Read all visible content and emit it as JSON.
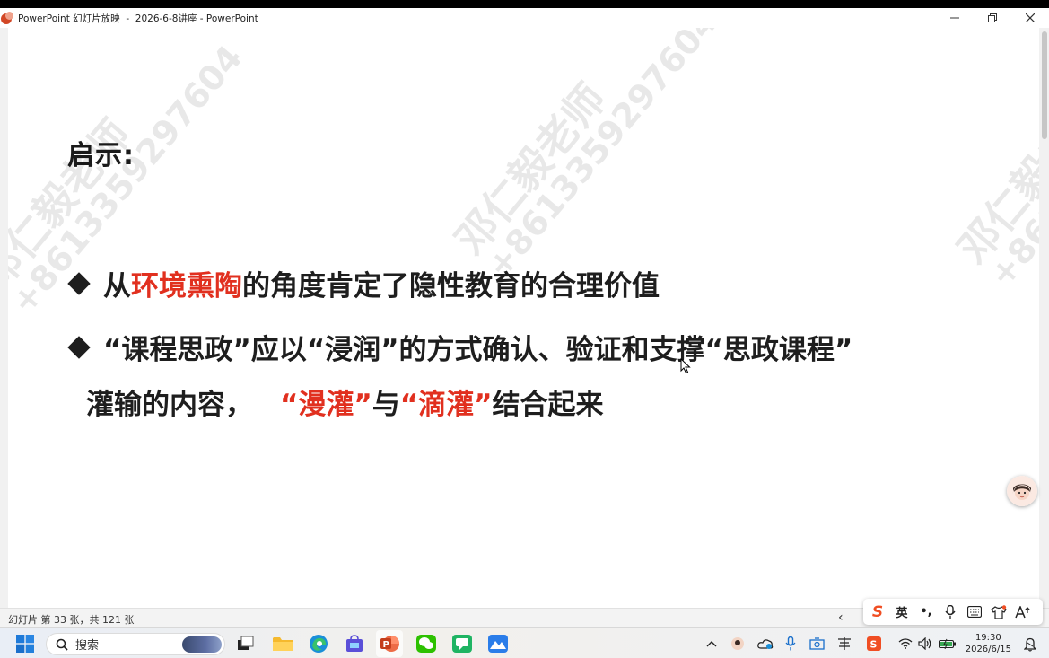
{
  "window": {
    "title": "PowerPoint 幻灯片放映  -  2026-6-8讲座 - PowerPoint"
  },
  "slide": {
    "title": "启示:",
    "watermark_name": "邓仁毅老师",
    "watermark_number": "+8613359297604",
    "bullet1": {
      "prefix": "从",
      "highlight": "环境熏陶",
      "suffix": "的角度肯定了隐性教育的合理价值"
    },
    "bullet2": {
      "line1": "“课程思政”应以“浸润”的方式确认、验证和支撑“思政课程”",
      "line2_prefix": "灌输的内容，",
      "highlight1": "“漫灌”",
      "middle": "与",
      "highlight2": "“滴灌”",
      "suffix": "结合起来"
    }
  },
  "statusbar": {
    "slide_count": "幻灯片 第 33 张，共 121 张",
    "prev_symbol": "‹"
  },
  "ime": {
    "logo": "S",
    "lang": "英",
    "punct": "•,"
  },
  "taskbar": {
    "search_label": "搜索",
    "clock_time": "19:30",
    "clock_date": "2026/6/15"
  },
  "colors": {
    "highlight_red": "#e1301f",
    "body_text": "#1e1e1e",
    "powerpoint": "#d24726"
  }
}
